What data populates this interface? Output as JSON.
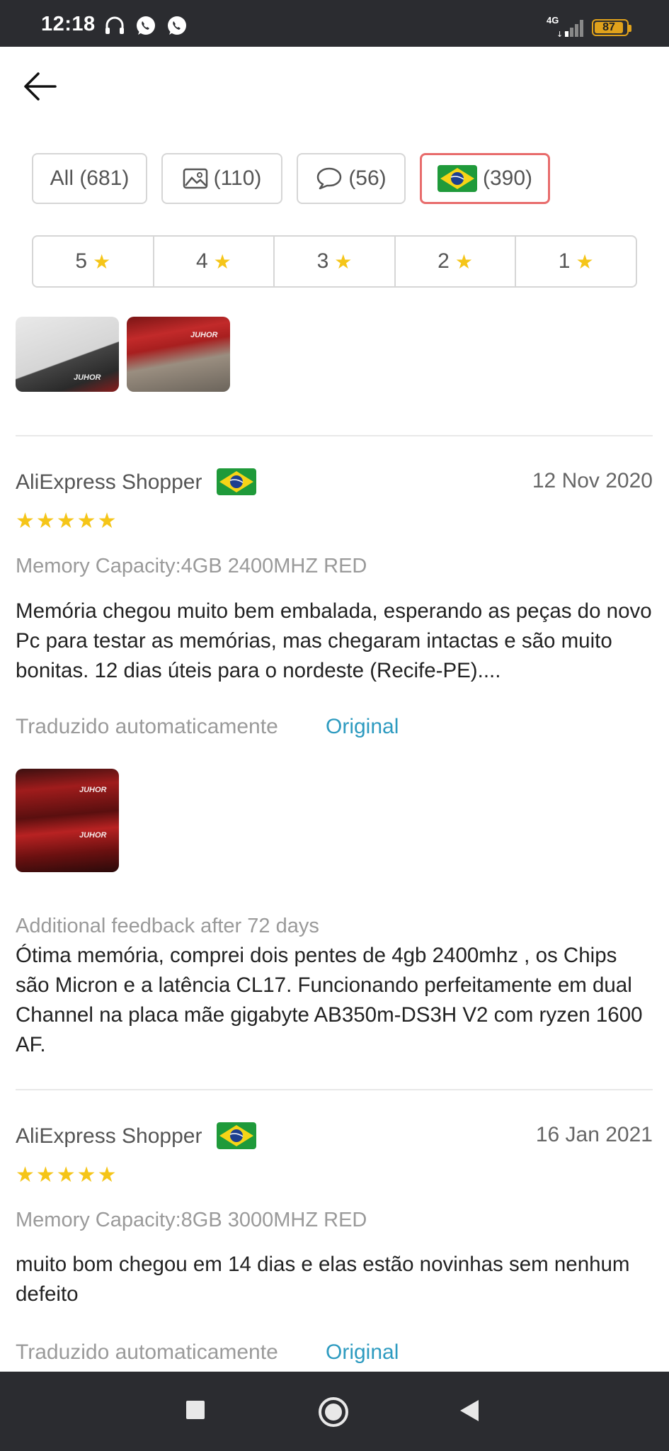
{
  "status_bar": {
    "time": "12:18",
    "network": "4G",
    "battery": "87",
    "icons": [
      "headphones-icon",
      "whatsapp-icon",
      "whatsapp-icon",
      "signal-icon",
      "battery-icon"
    ]
  },
  "header": {
    "back_icon": "arrow-left-icon"
  },
  "filters": [
    {
      "label": "All (681)",
      "icon": ""
    },
    {
      "label": "(110)",
      "icon": "image-icon"
    },
    {
      "label": "(56)",
      "icon": "comment-icon"
    },
    {
      "label": "(390)",
      "icon": "brazil-flag-icon",
      "active": true
    }
  ],
  "star_filters": [
    "5",
    "4",
    "3",
    "2",
    "1"
  ],
  "reviews": [
    {
      "author": "AliExpress Shopper",
      "date": "12 Nov 2020",
      "rating": 5,
      "variant": "Memory Capacity:4GB 2400MHZ RED",
      "text": "Memória chegou muito bem embalada, esperando as peças do novo Pc para testar as memórias, mas chegaram intactas e são muito bonitas. 12 dias úteis para o nordeste (Recife-PE)....",
      "translated_label": "Traduzido automaticamente",
      "original_label": "Original",
      "additional_label": "Additional feedback after 72 days",
      "additional_text": "Ótima memória, comprei dois pentes de 4gb 2400mhz , os Chips são Micron e a latência CL17. Funcionando perfeitamente em dual Channel na placa mãe gigabyte AB350m-DS3H V2 com ryzen 1600 AF."
    },
    {
      "author": "AliExpress Shopper",
      "date": "16 Jan 2021",
      "rating": 5,
      "variant": "Memory Capacity:8GB 3000MHZ RED",
      "text": "muito bom chegou em 14 dias e elas estão novinhas sem nenhum defeito",
      "translated_label": "Traduzido automaticamente",
      "original_label": "Original"
    }
  ],
  "thumb_brand": "JUHOR",
  "colors": {
    "accent_red": "#e86c6c",
    "link_blue": "#2e9bc0",
    "star_yellow": "#f5c518",
    "flag_green": "#1f9a3a",
    "flag_yellow": "#f7d417",
    "flag_blue": "#1d3f8f"
  },
  "nav_icons": [
    "recent-apps-icon",
    "home-icon",
    "back-triangle-icon"
  ]
}
